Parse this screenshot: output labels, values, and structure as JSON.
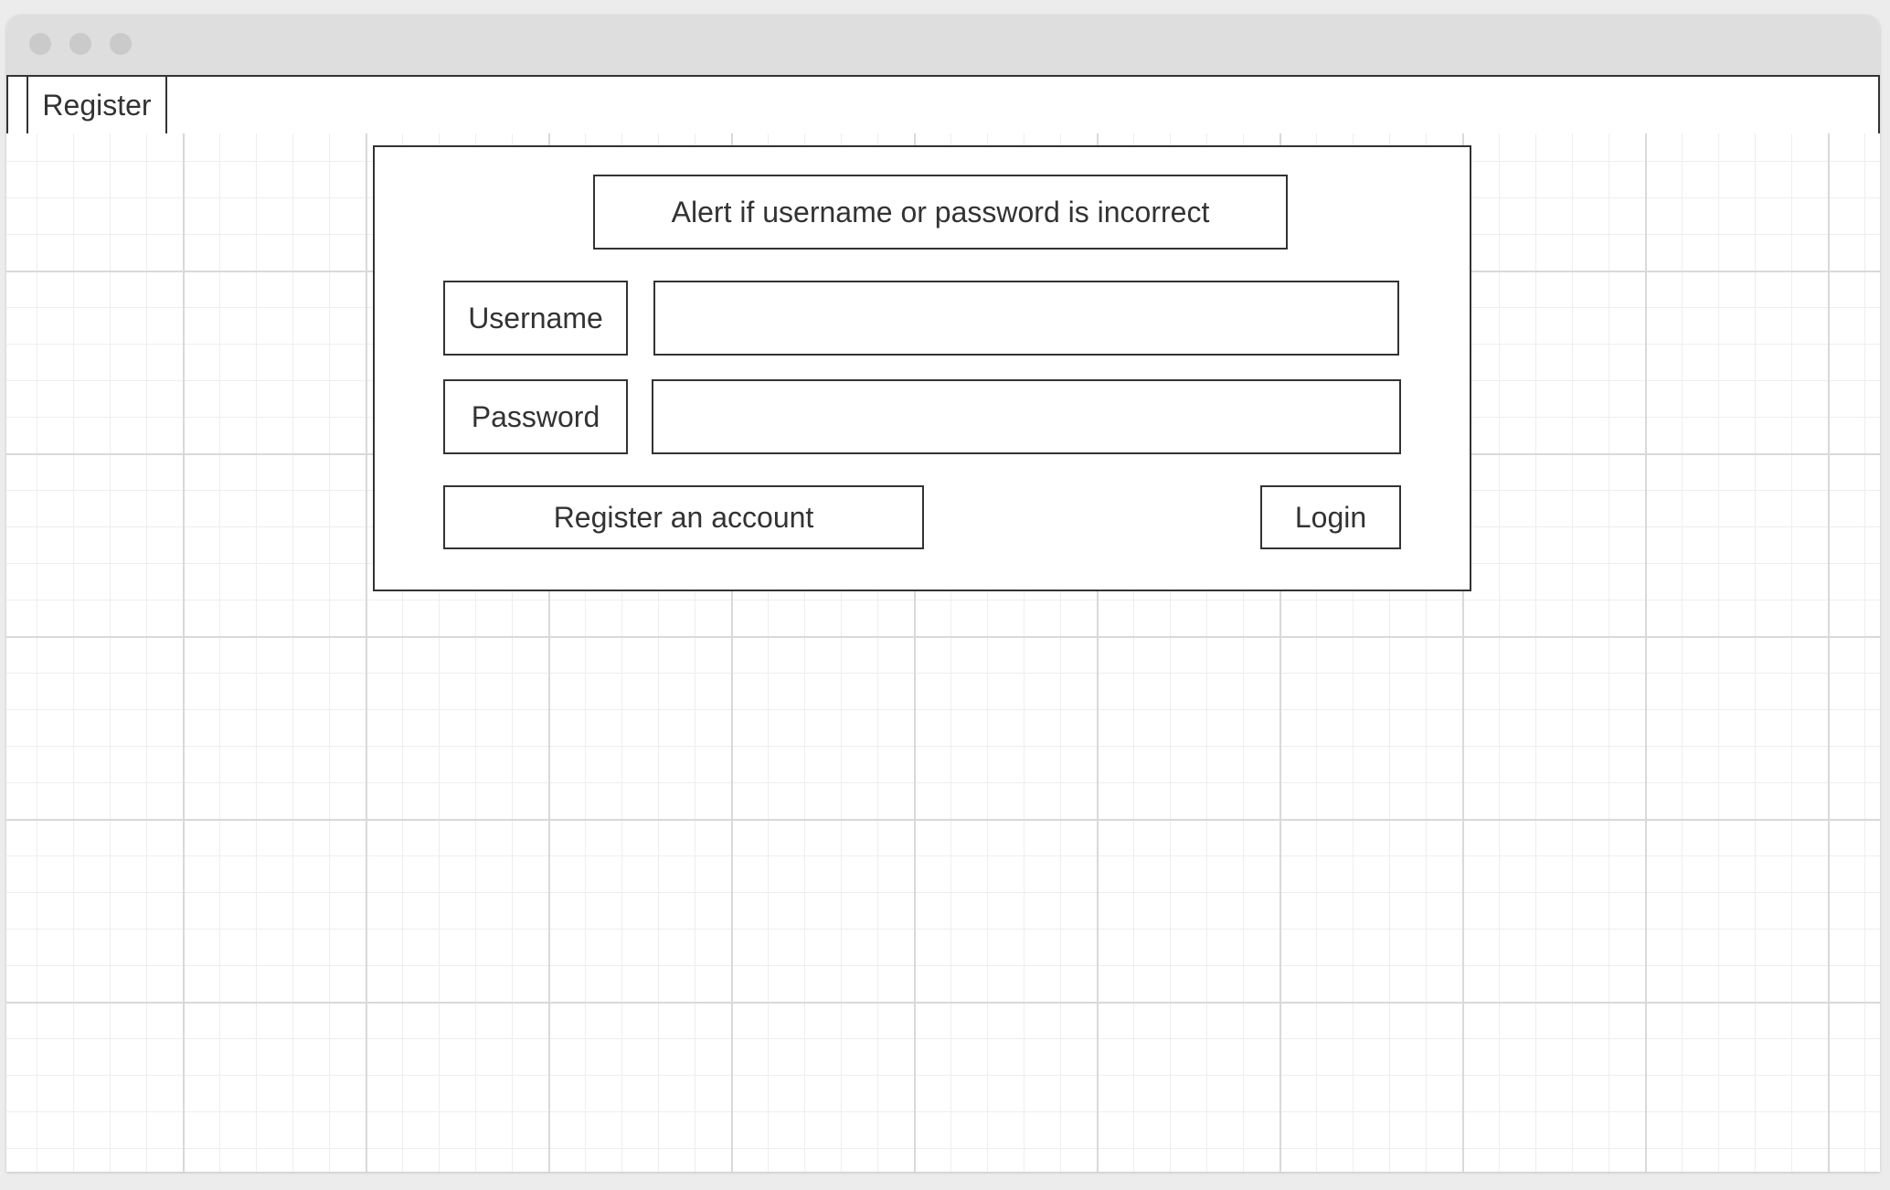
{
  "tabs": [
    {
      "label": "Register"
    }
  ],
  "form": {
    "alert_text": "Alert if username or password is incorrect",
    "username_label": "Username",
    "username_value": "",
    "password_label": "Password",
    "password_value": "",
    "register_button": "Register an account",
    "login_button": "Login"
  },
  "colors": {
    "border": "#333333",
    "titlebar": "#dedede",
    "window_dot": "#cacaca",
    "grid_major": "#d9d9d9",
    "grid_minor": "#eeeeee"
  }
}
